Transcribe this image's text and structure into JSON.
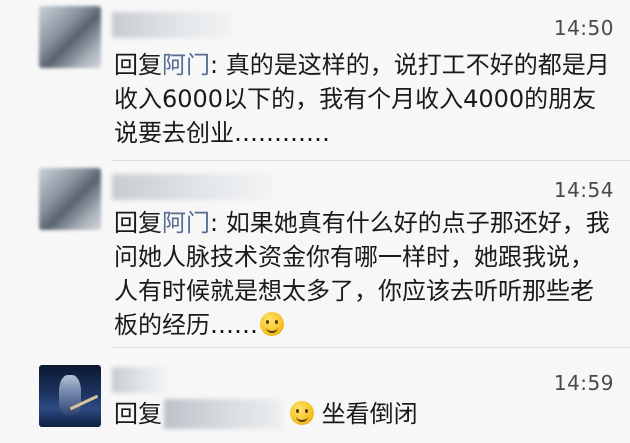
{
  "comments": [
    {
      "time": "14:50",
      "reply_prefix": "回复",
      "reply_name": "阿门",
      "text": ": 真的是这样的，说打工不好的都是月收入6000以下的，我有个月收入4000的朋友说要去创业…………",
      "avatar_icon": "blurred-avatar"
    },
    {
      "time": "14:54",
      "reply_prefix": "回复",
      "reply_name": "阿门",
      "text": ": 如果她真有什么好的点子那还好，我问她人脉技术资金你有哪一样时，她跟我说，人有时候就是想太多了，你应该去听听那些老板的经历……",
      "emoji": "smile-emoji",
      "avatar_icon": "blurred-avatar"
    },
    {
      "time": "14:59",
      "reply_prefix": "回复",
      "text": "坐看倒闭",
      "emoji": "smile-emoji",
      "avatar_icon": "guitarist-avatar"
    }
  ],
  "colors": {
    "background": "#f7f7f7",
    "reply_name": "#576b95",
    "text": "#1a1a1a",
    "time": "#4a4a4a",
    "divider": "#dcdcdc"
  }
}
